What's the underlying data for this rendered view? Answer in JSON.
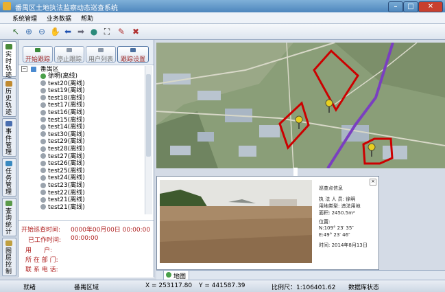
{
  "window": {
    "title": "番禺区土地执法监察动态巡查系统"
  },
  "menu": [
    "系统管理",
    "业务数据",
    "帮助"
  ],
  "sidebar_tabs": [
    "实时轨迹",
    "历史轨迹",
    "事件管理",
    "任务管理",
    "查询统计",
    "图层控制"
  ],
  "panel": {
    "buttons": [
      "开始跟踪",
      "停止跟踪",
      "用户列表",
      "跟踪设置"
    ],
    "tree_root": "番禺区",
    "tree_items": [
      "徐明(离线)",
      "test20(离线)",
      "test19(离线)",
      "test18(离线)",
      "test17(离线)",
      "test16(离线)",
      "test15(离线)",
      "test14(离线)",
      "test30(离线)",
      "test29(离线)",
      "test28(离线)",
      "test27(离线)",
      "test26(离线)",
      "test25(离线)",
      "test24(离线)",
      "test23(离线)",
      "test22(离线)",
      "test21(离线)",
      "test21(离线)"
    ]
  },
  "info": {
    "start_label": "开始巡查时间:",
    "start_value": "0000年00月00日 00:00:00",
    "worked_label": "已工作时间:",
    "worked_value": "00:00:00",
    "user_label": "用　　户:",
    "dept_label": "所 在 部 门:",
    "phone_label": "联 系 电 话:"
  },
  "popup": {
    "title": "巡查点信息",
    "lines": [
      "执 法 人 员:  徐明",
      "用地类型:  违法用地",
      "面积:  2450.5m²",
      "",
      "位置:",
      "N:109°  23′  35″",
      "E:49°  23′  46″",
      "",
      "时间:  2014年8月13日"
    ]
  },
  "map_tab": "地图",
  "status": {
    "ready": "就绪",
    "area": "番禺区域",
    "x": "X = 253117.80",
    "y": "Y = 441587.39",
    "scale": "比例尺：1:106401.62",
    "db": "数据库状态"
  },
  "colors": {
    "title_bar": "#4d86bd",
    "danger": "#cc0000",
    "road": "#7a3fc0",
    "marker": "#e8d020"
  }
}
